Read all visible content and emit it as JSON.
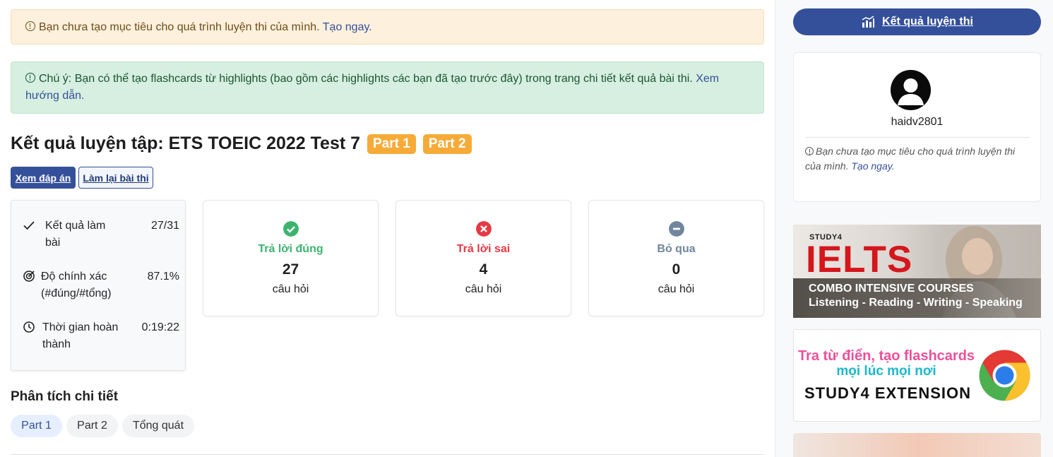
{
  "alerts": {
    "goal_text": "Bạn chưa tạo mục tiêu cho quá trình luyện thi của mình.",
    "goal_link": "Tạo ngay.",
    "note_text": "Chú ý: Bạn có thể tạo flashcards từ highlights (bao gồm các highlights các bạn đã tạo trước đây) trong trang chi tiết kết quả bài thi.",
    "note_link": "Xem hướng dẫn."
  },
  "header": {
    "title": "Kết quả luyện tập: ETS TOEIC 2022 Test 7",
    "badges": [
      "Part 1",
      "Part 2"
    ]
  },
  "actions": {
    "view_answers": "Xem đáp án",
    "retake": "Làm lại bài thi"
  },
  "summary": {
    "result_label": "Kết quả làm bài",
    "result_value": "27/31",
    "accuracy_label": "Độ chính xác (#đúng/#tổng)",
    "accuracy_value": "87.1%",
    "time_label": "Thời gian hoàn thành",
    "time_value": "0:19:22"
  },
  "stats": [
    {
      "label": "Trả lời đúng",
      "count": "27",
      "unit": "câu hỏi",
      "color": "#3cb46e",
      "icon": "check-circle-icon"
    },
    {
      "label": "Trả lời sai",
      "count": "4",
      "unit": "câu hỏi",
      "color": "#e43a45",
      "icon": "x-circle-icon"
    },
    {
      "label": "Bỏ qua",
      "count": "0",
      "unit": "câu hỏi",
      "color": "#71869d",
      "icon": "minus-circle-icon"
    }
  ],
  "analysis": {
    "title": "Phân tích chi tiết",
    "tabs": [
      "Part 1",
      "Part 2",
      "Tổng quát"
    ],
    "active_tab": "Part 1"
  },
  "sidebar": {
    "results_button": "Kết quả luyện thi",
    "username": "haidv2801",
    "goal_note": "Bạn chưa tạo mục tiêu cho quá trình luyện thi của mình.",
    "goal_link": "Tạo ngay.",
    "ielts_banner": {
      "brand": "STUDY4",
      "title": "IELTS",
      "subtitle": "COMBO INTENSIVE COURSES",
      "skills": "Listening - Reading - Writing - Speaking"
    },
    "extension_banner": {
      "line1": "Tra từ điển, tạo flashcards",
      "line2": "mọi lúc mọi nơi",
      "line3": "STUDY4 EXTENSION"
    }
  },
  "colors": {
    "primary": "#35509a",
    "badge": "#f6ab38"
  }
}
